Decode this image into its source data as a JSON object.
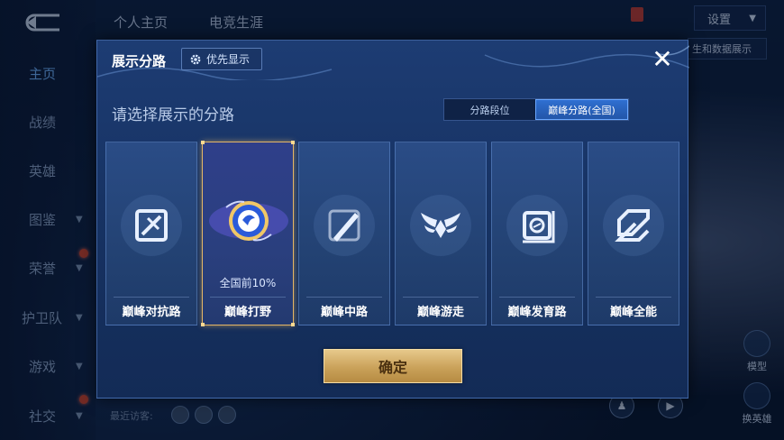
{
  "left_nav": {
    "items": [
      {
        "label": "主页",
        "active": true,
        "chevron": false
      },
      {
        "label": "战绩",
        "active": false,
        "chevron": false
      },
      {
        "label": "英雄",
        "active": false,
        "chevron": false
      },
      {
        "label": "图鉴",
        "active": false,
        "chevron": true
      },
      {
        "label": "荣誉",
        "active": false,
        "chevron": true,
        "badge": true
      },
      {
        "label": "护卫队",
        "active": false,
        "chevron": true
      },
      {
        "label": "游戏",
        "active": false,
        "chevron": true
      },
      {
        "label": "社交",
        "active": false,
        "chevron": true,
        "badge": true
      }
    ]
  },
  "top_bar": {
    "tabs": [
      "个人主页",
      "电竞生涯"
    ],
    "settings_label": "设置",
    "right_panel_label": "生和数据展示"
  },
  "bottom": {
    "recent_visitors_label": "最近访客:",
    "side_buttons": [
      "模型",
      "换英雄"
    ]
  },
  "modal": {
    "title": "展示分路",
    "priority_button": "优先显示",
    "prompt": "请选择展示的分路",
    "segmented": {
      "options": [
        "分路段位",
        "巅峰分路(全国)"
      ],
      "selected_index": 1
    },
    "cards": [
      {
        "name": "巅峰对抗路",
        "icon": "sword-slash-icon",
        "selected": false,
        "rank": ""
      },
      {
        "name": "巅峰打野",
        "icon": "jungle-emblem-icon",
        "selected": true,
        "rank": "全国前10%"
      },
      {
        "name": "巅峰中路",
        "icon": "mid-lane-icon",
        "selected": false,
        "rank": ""
      },
      {
        "name": "巅峰游走",
        "icon": "wings-icon",
        "selected": false,
        "rank": ""
      },
      {
        "name": "巅峰发育路",
        "icon": "farm-lane-icon",
        "selected": false,
        "rank": ""
      },
      {
        "name": "巅峰全能",
        "icon": "all-round-icon",
        "selected": false,
        "rank": ""
      }
    ],
    "confirm_label": "确定"
  },
  "colors": {
    "modal_bg": "#173364",
    "accent_blue": "#2f6fd1",
    "gold": "#caa25a",
    "selected_border": "#e3b566"
  }
}
